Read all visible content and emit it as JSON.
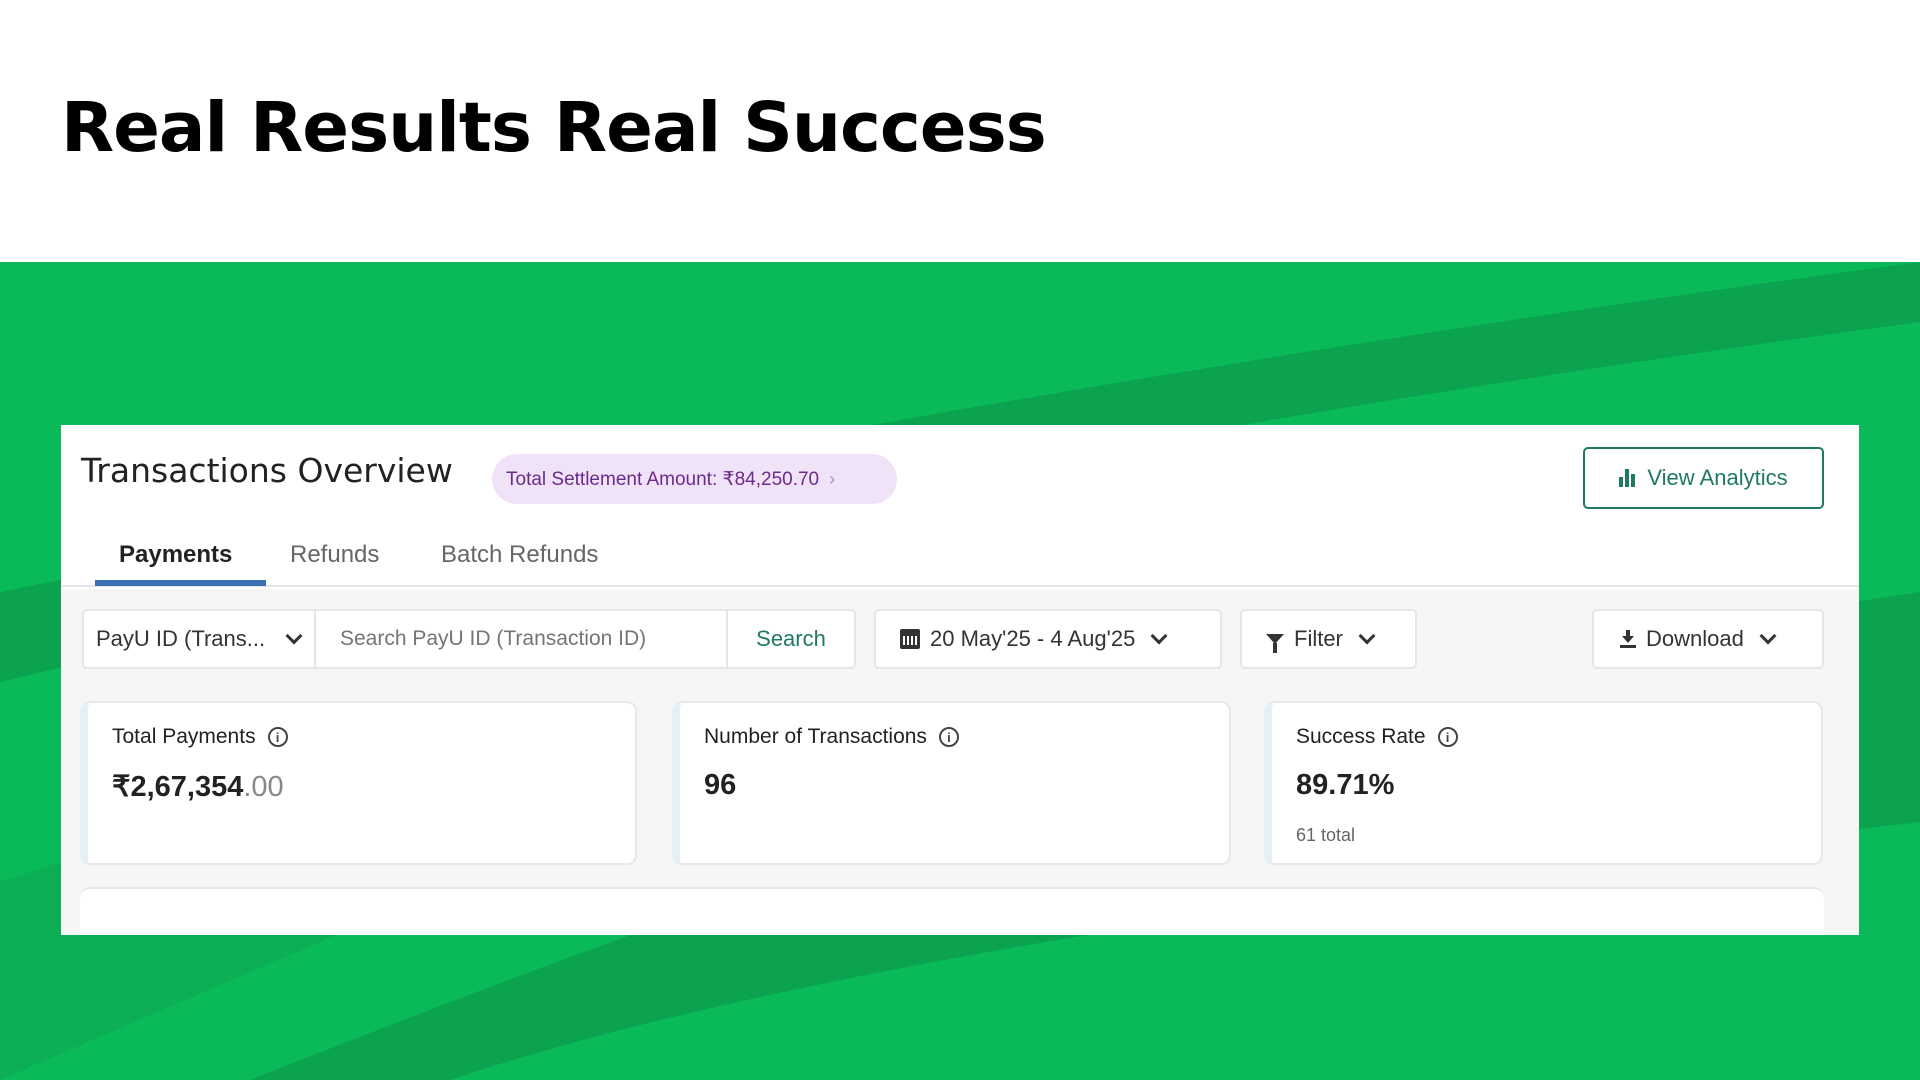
{
  "slide": {
    "headline": "Real Results Real Success"
  },
  "colors": {
    "background_green": "#0ab957",
    "accent_teal": "#1f7a63",
    "tab_underline": "#3b6fb6",
    "settlement_pill_bg": "#f0e3f7",
    "settlement_pill_text": "#6b2a8c"
  },
  "header": {
    "title": "Transactions Overview",
    "settlement_label": "Total Settlement Amount: ₹84,250.70",
    "settlement_icon": "chevron-right-icon",
    "view_analytics_label": "View Analytics",
    "view_analytics_icon": "bar-chart-icon"
  },
  "tabs": [
    {
      "label": "Payments",
      "active": true
    },
    {
      "label": "Refunds",
      "active": false
    },
    {
      "label": "Batch Refunds",
      "active": false
    }
  ],
  "toolbar": {
    "id_type_selected": "PayU ID (Trans...",
    "search_placeholder": "Search PayU ID (Transaction ID)",
    "search_label": "Search",
    "date_range": "20 May'25 - 4 Aug'25",
    "filter_label": "Filter",
    "download_label": "Download"
  },
  "stats": [
    {
      "label": "Total Payments",
      "value_main": "₹2,67,354",
      "value_decimals": ".00",
      "sub": ""
    },
    {
      "label": "Number of Transactions",
      "value_main": "96",
      "value_decimals": "",
      "sub": ""
    },
    {
      "label": "Success Rate",
      "value_main": "89.71%",
      "value_decimals": "",
      "sub": "61 total"
    }
  ]
}
